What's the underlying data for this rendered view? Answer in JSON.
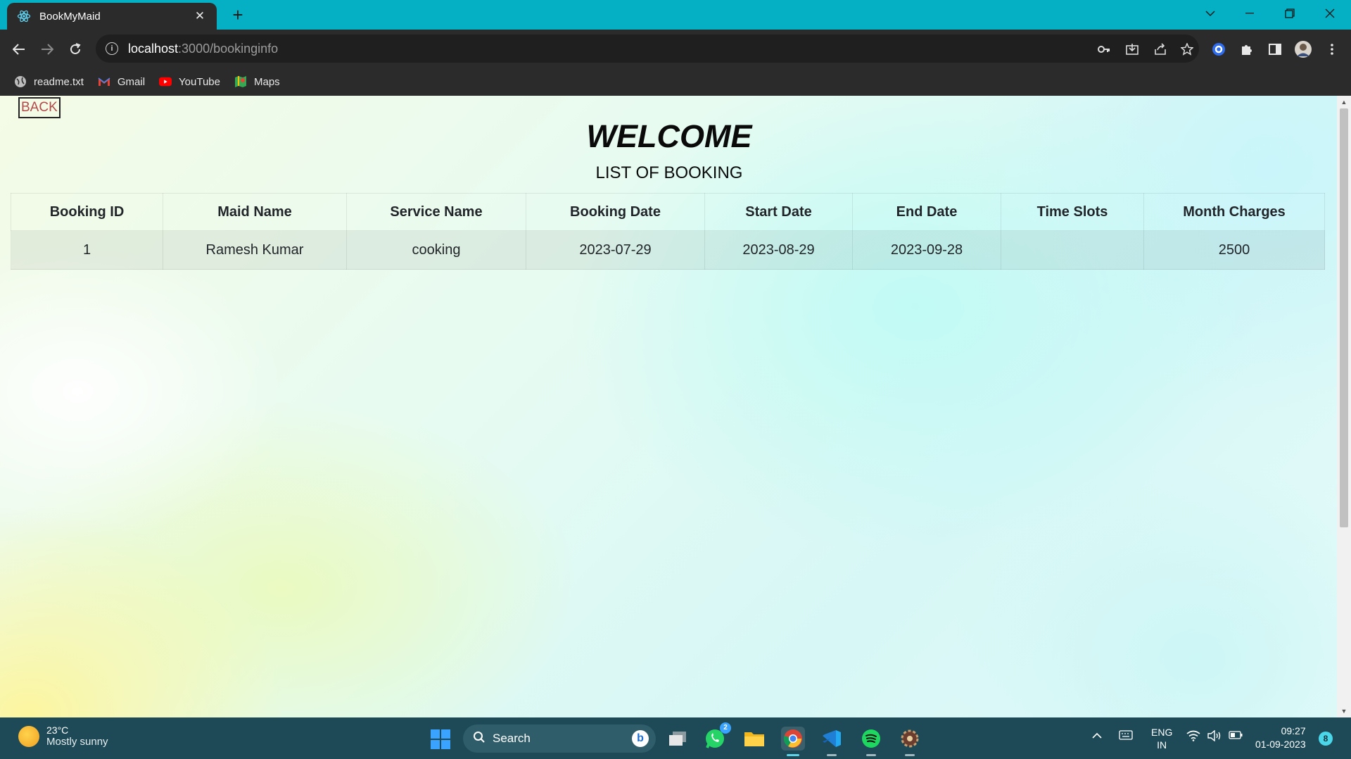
{
  "browser": {
    "tab_title": "BookMyMaid",
    "tab_close": "✕",
    "new_tab": "+",
    "url_host": "localhost",
    "url_path": ":3000/bookinginfo",
    "bookmarks": [
      {
        "label": "readme.txt",
        "icon": "globe-icon"
      },
      {
        "label": "Gmail",
        "icon": "gmail-icon"
      },
      {
        "label": "YouTube",
        "icon": "youtube-icon"
      },
      {
        "label": "Maps",
        "icon": "maps-icon"
      }
    ]
  },
  "page": {
    "back_label": "BACK",
    "welcome": "WELCOME",
    "subtitle": "LIST OF BOOKING",
    "table": {
      "headers": [
        "Booking ID",
        "Maid Name",
        "Service Name",
        "Booking Date",
        "Start Date",
        "End Date",
        "Time Slots",
        "Month Charges"
      ],
      "rows": [
        [
          "1",
          "Ramesh Kumar",
          "cooking",
          "2023-07-29",
          "2023-08-29",
          "2023-09-28",
          "",
          "2500"
        ]
      ]
    }
  },
  "taskbar": {
    "weather_temp": "23°C",
    "weather_desc": "Mostly sunny",
    "search_label": "Search",
    "whatsapp_badge": "2",
    "lang_line1": "ENG",
    "lang_line2": "IN",
    "time": "09:27",
    "date": "01-09-2023",
    "notification_count": "8"
  },
  "colors": {
    "tabbar": "#05b0c4",
    "chrome_dark": "#2b2b2b",
    "taskbar": "#1e4a57",
    "back_text": "#b34a4a"
  }
}
